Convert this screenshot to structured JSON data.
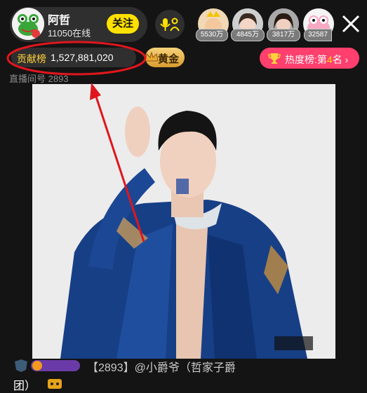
{
  "host": {
    "name": "阿哲",
    "online": "11050在线",
    "follow_label": "关注"
  },
  "viewers": [
    {
      "badge": "5530万"
    },
    {
      "badge": "4845万"
    },
    {
      "badge": "3817万"
    },
    {
      "badge": "32587"
    }
  ],
  "contribution": {
    "label": "贡献榜",
    "value": "1,527,881,020"
  },
  "level_badge": "黄金",
  "heat": {
    "label": "热度榜:第",
    "rank": "4",
    "suffix": "名",
    "chevron": "›"
  },
  "room_id": "直播间号 2893",
  "chat": {
    "line1": "【2893】@小爵爷（哲家子爵",
    "line2": "团）"
  },
  "colors": {
    "accent_yellow": "#ffe100",
    "heat_pink": "#ff3f6d",
    "annotation_red": "#e0161d"
  }
}
